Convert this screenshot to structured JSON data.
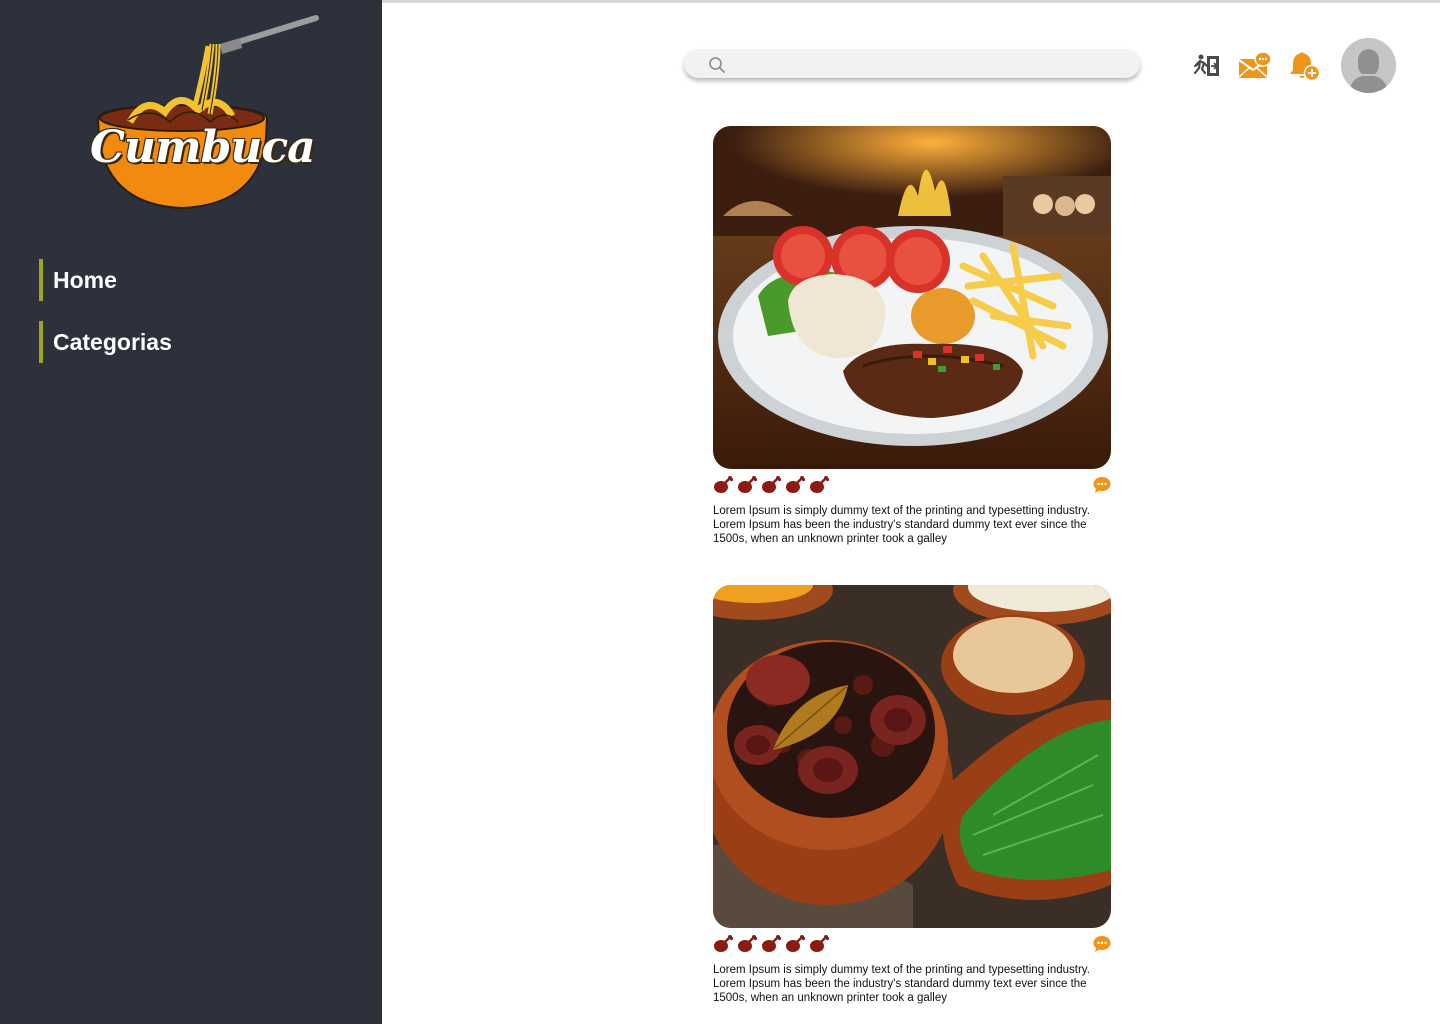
{
  "brand": {
    "name": "Cumbuca"
  },
  "sidebar": {
    "items": [
      {
        "label": "Home"
      },
      {
        "label": "Categorias"
      }
    ]
  },
  "header": {
    "search": {
      "placeholder": "",
      "value": ""
    },
    "icons": [
      "logout-icon",
      "messages-icon",
      "notification-add-icon",
      "avatar"
    ]
  },
  "feed": {
    "posts": [
      {
        "image": "grilled-steak-plate",
        "rating": 5,
        "rating_icon": "drumstick-icon",
        "description": "Lorem Ipsum is simply dummy text of the printing and typesetting industry. Lorem Ipsum has been the industry's standard dummy text ever since the 1500s, when an unknown printer took a galley"
      },
      {
        "image": "feijoada-bowls",
        "rating": 5,
        "rating_icon": "drumstick-icon",
        "description": "Lorem Ipsum is simply dummy text of the printing and typesetting industry. Lorem Ipsum has been the industry's standard dummy text ever since the 1500s, when an unknown printer took a galley"
      }
    ]
  },
  "colors": {
    "sidebar": "#2d313b",
    "accent": "#f0951a",
    "nav_marker": "#9ca816",
    "rating": "#8a1a12"
  }
}
